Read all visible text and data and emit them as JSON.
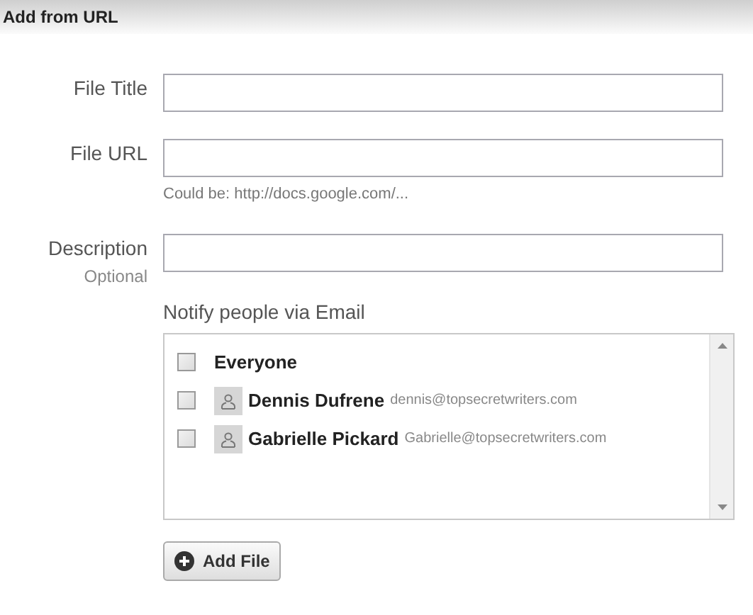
{
  "header": {
    "title": "Add from URL"
  },
  "fields": [
    {
      "label": "File Title"
    },
    {
      "label": "File URL",
      "hint": "Could be: http://docs.google.com/..."
    },
    {
      "label": "Description",
      "sublabel": "Optional"
    }
  ],
  "notify": {
    "label": "Notify people via Email",
    "recipients": [
      {
        "kind": "group",
        "name": "Everyone",
        "checked": false
      },
      {
        "kind": "person",
        "name": "Dennis Dufrene",
        "email": "dennis@topsecretwriters.com",
        "checked": false
      },
      {
        "kind": "person",
        "name": "Gabrielle Pickard",
        "email": "Gabrielle@topsecretwriters.com",
        "checked": false
      }
    ]
  },
  "button": {
    "label": "Add File"
  }
}
